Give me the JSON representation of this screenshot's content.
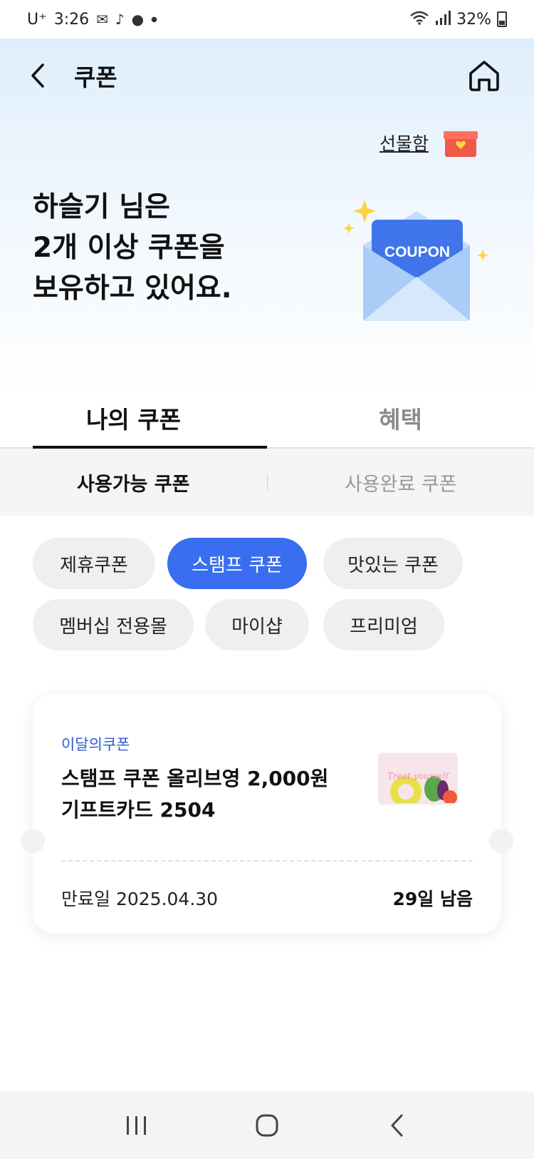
{
  "status_bar": {
    "carrier": "U⁺",
    "time": "3:26",
    "battery": "32%"
  },
  "header": {
    "title": "쿠폰",
    "back_icon": "chevron-left-icon",
    "home_icon": "home-icon"
  },
  "gift_box": {
    "label": "선물함",
    "icon": "gift-box-icon"
  },
  "hero": {
    "lines": [
      "하슬기 님은",
      "2개 이상 쿠폰을",
      "보유하고 있어요."
    ],
    "illustration_text": "COUPON"
  },
  "tabs": [
    {
      "label": "나의 쿠폰",
      "active": true
    },
    {
      "label": "혜택",
      "active": false
    }
  ],
  "subtabs": [
    {
      "label": "사용가능 쿠폰",
      "active": true
    },
    {
      "label": "사용완료 쿠폰",
      "active": false
    }
  ],
  "filter_chips": [
    {
      "label": "제휴쿠폰",
      "active": false
    },
    {
      "label": "스탬프 쿠폰",
      "active": true
    },
    {
      "label": "맛있는 쿠폰",
      "active": false
    },
    {
      "label": "멤버십 전용몰",
      "active": false
    },
    {
      "label": "마이샵",
      "active": false
    },
    {
      "label": "프리미엄",
      "active": false
    }
  ],
  "coupon": {
    "tag": "이달의쿠폰",
    "title_line1": "스탬프 쿠폰 올리브영 2,000원",
    "title_line2": "기프트카드 2504",
    "expiry": "만료일 2025.04.30",
    "remaining": "29일 남음",
    "thumbnail_text": "Treat yourself"
  },
  "colors": {
    "accent": "#3a6ef0",
    "tag_blue": "#2d5ad6",
    "hero_bg": "#d9ecfb"
  }
}
